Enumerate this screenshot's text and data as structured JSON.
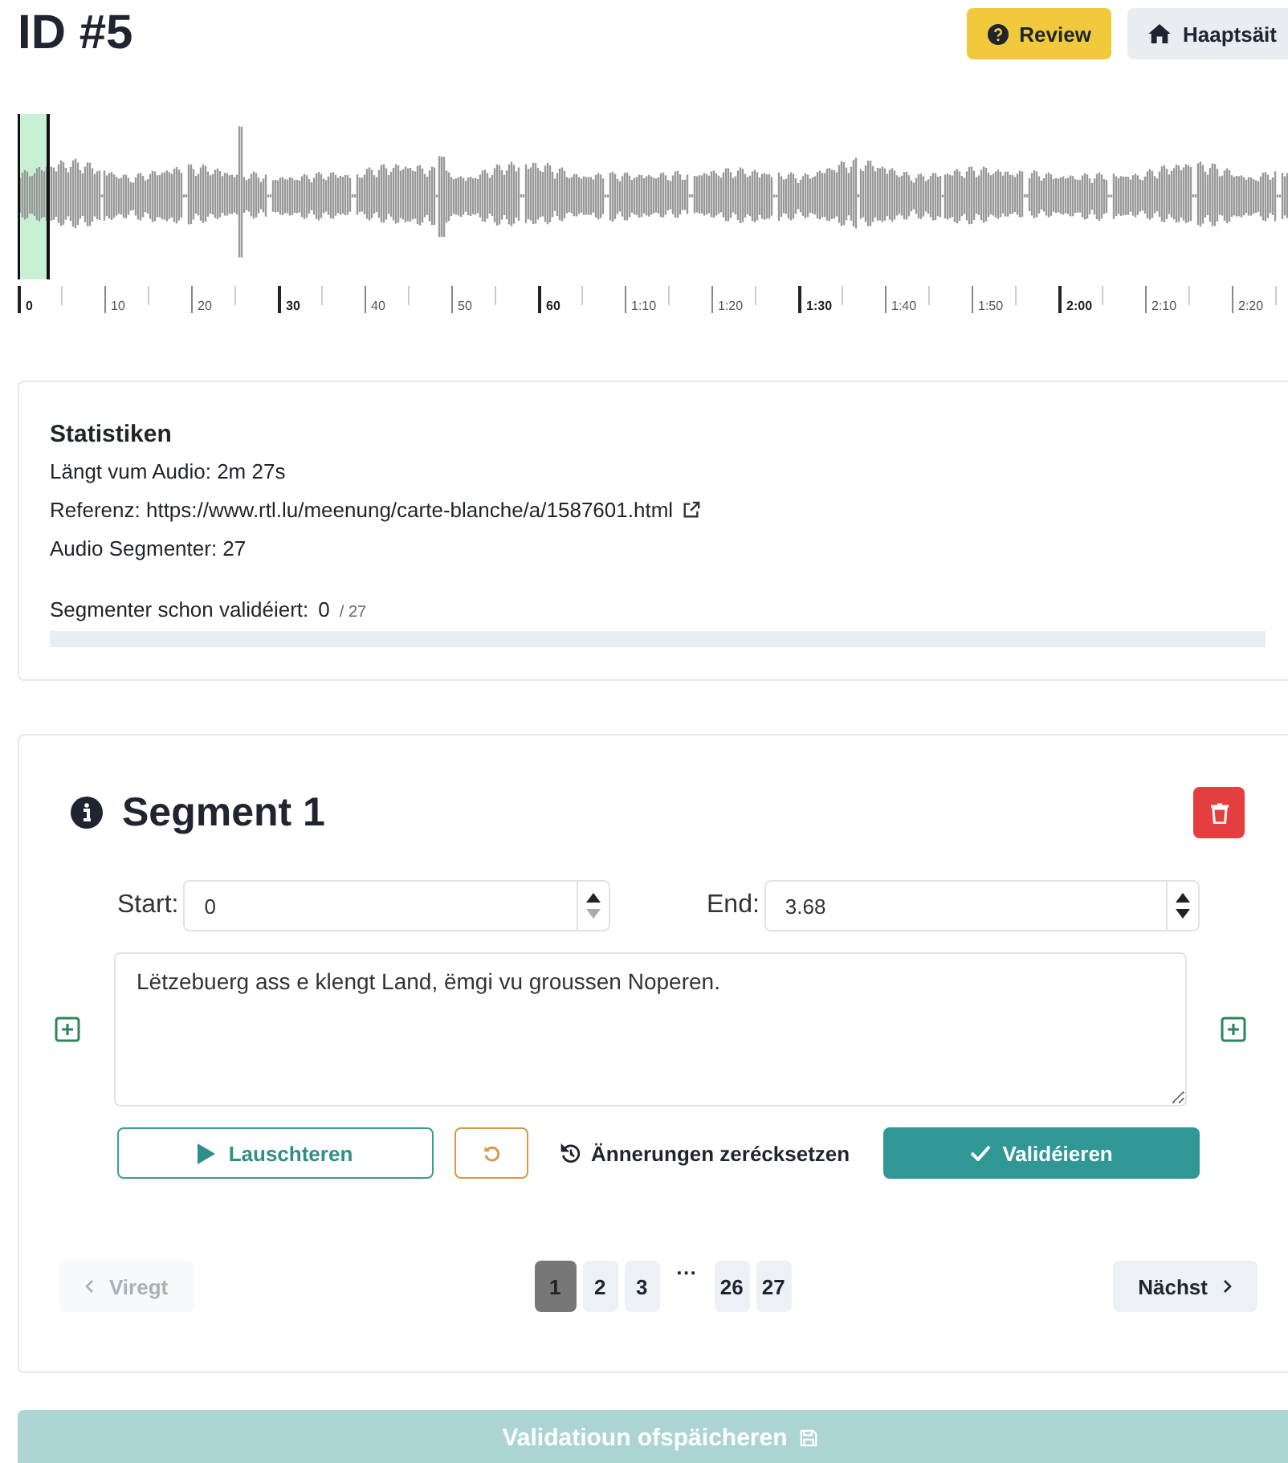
{
  "header": {
    "title": "ID #5",
    "buttons": [
      {
        "kind": "review",
        "label": "Review"
      },
      {
        "kind": "home",
        "label": "Haaptsäit"
      }
    ]
  },
  "timeline": {
    "ticks": [
      {
        "label": "0",
        "major": true
      },
      {
        "label": "10",
        "major": false
      },
      {
        "label": "20",
        "major": false
      },
      {
        "label": "30",
        "major": true
      },
      {
        "label": "40",
        "major": false
      },
      {
        "label": "50",
        "major": false
      },
      {
        "label": "60",
        "major": true
      },
      {
        "label": "1:10",
        "major": false
      },
      {
        "label": "1:20",
        "major": false
      },
      {
        "label": "1:30",
        "major": true
      },
      {
        "label": "1:40",
        "major": false
      },
      {
        "label": "1:50",
        "major": false
      },
      {
        "label": "2:00",
        "major": true
      },
      {
        "label": "2:10",
        "major": false
      },
      {
        "label": "2:20",
        "major": false
      }
    ]
  },
  "stats": {
    "title": "Statistiken",
    "lines": [
      {
        "kind": "text",
        "text": "Längt vum Audio: 2m 27s"
      },
      {
        "kind": "link",
        "text": "Referenz: https://www.rtl.lu/meenung/carte-blanche/a/1587601.html"
      },
      {
        "kind": "text",
        "text": "Audio Segmenter: 27"
      }
    ],
    "progress_label": "Segmenter schon validéiert:",
    "progress_count": "0",
    "progress_total": "/ 27",
    "level": 0
  },
  "segment": {
    "title": "Segment 1",
    "fields": [
      {
        "label": "Start:",
        "value": "0",
        "down_disabled": true
      },
      {
        "label": "End:",
        "value": "3.68",
        "down_disabled": false
      }
    ],
    "text": "Lëtzebuerg ass e klengt Land, ëmgi vu groussen Noperen.",
    "listen": "Lauschteren",
    "reset": "Ännerungen zerécksetzen",
    "validate": "Validéieren"
  },
  "pagination": {
    "prev": {
      "label": "Viregt",
      "disabled": true
    },
    "next": {
      "label": "Nächst",
      "disabled": false
    },
    "pages": [
      {
        "kind": "page",
        "label": "1",
        "selected": true
      },
      {
        "kind": "page",
        "label": "2",
        "selected": false
      },
      {
        "kind": "page",
        "label": "3",
        "selected": false
      },
      {
        "kind": "gap",
        "label": "···"
      },
      {
        "kind": "page",
        "label": "26",
        "selected": false
      },
      {
        "kind": "page",
        "label": "27",
        "selected": false
      }
    ]
  },
  "save": {
    "label": "Validatioun ofspäicheren",
    "disabled": true
  }
}
